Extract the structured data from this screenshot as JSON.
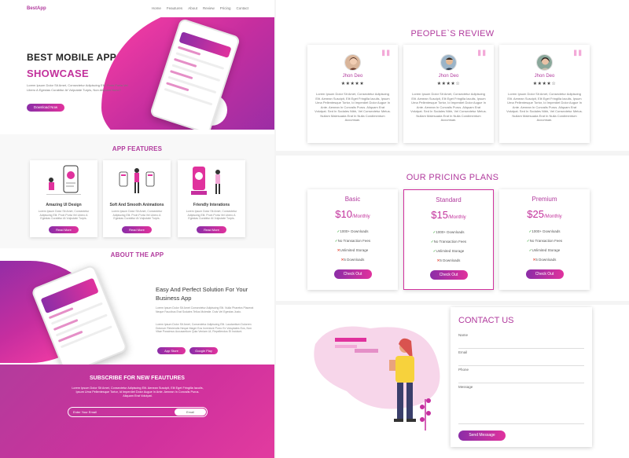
{
  "nav": {
    "logo": "BestApp",
    "items": [
      "Home",
      "Feautures",
      "About",
      "Review",
      "Pricing",
      "Contact"
    ]
  },
  "hero": {
    "title": "BEST MOBILE APP",
    "subtitle": "SHOWCASE",
    "text": "Lorem Ipsum Dolor Sit Amet, Consectetur Adipiscing Elit. Proin Porta Vel Libero A Egestas Curabitur At Vulputate Turpis, Non Aliquam Nunc?",
    "button": "Download Now"
  },
  "features": {
    "title": "APP FEATURES",
    "cards": [
      {
        "name": "Amazing UI Design",
        "desc": "Lorem Ipsum Dolor Sit Amet, Consectetur Adipiscing Elit. Proin Porta Vel Libero A Egestas Curabitur At Vulputate Turpis.",
        "button": "Read More"
      },
      {
        "name": "Soft And Smooth Animations",
        "desc": "Lorem Ipsum Dolor Sit Amet, Consectetur Adipiscing Elit. Proin Porta Vel Libero A Egestas Curabitur At Vulputate Turpis.",
        "button": "Read More"
      },
      {
        "name": "Friendly Interations",
        "desc": "Lorem Ipsum Dolor Sit Amet, Consectetur Adipiscing Elit. Proin Porta Vel Libero A Egestas Curabitur At Vulputate Turpis.",
        "button": "Read More"
      }
    ]
  },
  "about": {
    "title": "ABOUT THE APP",
    "heading": "Easy And Perfect Solution For Your Business App",
    "p1": "Lorem Ipsum Dolor Sit Amet Consectetur Adipiscing Elit. Nulla Pharetra Placerat Neque Faucibus Erat Sodales Tellus Molestie. Duis Vel Egestas Justo.",
    "p2": "Lorem Ipsum Dolor Sit Amet, Consectetur Adipiscing Elit. Laudantium Dolorem Dolorum Reiciendis Neque Magni Eos Inventore Porro Ex Voluptates Eos, Non Vitae Possimus Accusantium Quia Veniam Ut, Repellendus Et Incidunt.",
    "store1": "App Store",
    "store2": "Google Play"
  },
  "subscribe": {
    "title": "SUBSCRIBE FOR NEW FEAUTURES",
    "text": "Lorem Ipsum Dolor Sit Amet, Consectetur Adipiscing Elit. Aenean Suscipit, Elit Eget Fringilla Iaculis, Ipsum Urna Pellentesque Tortor, Id Imperdiet Dolor Augue In Ante. Aenean In Convalis Purus. Aliquam Erat Volutpat.",
    "placeholder": "Enter Your Email",
    "button": "Email"
  },
  "reviews": {
    "title": "PEOPLE`S REVIEW",
    "cards": [
      {
        "name": "Jhon Deo",
        "stars": "★★★★★",
        "text": "Lorem Ipsum Dolor Sit Amet, Consectetur Adipiscing Elit. Aenean Suscipit, Elit Eget Fringilla Iaculis, Ipsum Urna Pellentesque Tortor, Id Imperdiet Dolor Augue In Ante. Aenean In Convalis Purus. Aliquam Erat Volutpat. Sed In Sodales Nibh, Vel Consectetur Metus. Nullam Malesuada Erat In Nulla Condimentum Accumsan."
      },
      {
        "name": "Jhon Deo",
        "stars": "★★★★☆",
        "text": "Lorem Ipsum Dolor Sit Amet, Consectetur Adipiscing Elit. Aenean Suscipit, Elit Eget Fringilla Iaculis, Ipsum Urna Pellentesque Tortor, Id Imperdiet Dolor Augue In Ante. Aenean In Convalis Purus. Aliquam Erat Volutpat. Sed In Sodales Nibh, Vel Consectetur Metus. Nullam Malesuada Erat In Nulla Condimentum Accumsan."
      },
      {
        "name": "Jhon Deo",
        "stars": "★★★★☆",
        "text": "Lorem Ipsum Dolor Sit Amet, Consectetur Adipiscing Elit. Aenean Suscipit, Elit Eget Fringilla Iaculis, Ipsum Urna Pellentesque Tortor, Id Imperdiet Dolor Augue In Ante. Aenean In Convalis Purus. Aliquam Erat Volutpat. Sed In Sodales Nibh, Vel Consectetur Metus. Nullam Malesuada Erat In Nulla Condimentum Accumsan."
      }
    ]
  },
  "pricing": {
    "title": "OUR PRICING PLANS",
    "plans": [
      {
        "name": "Basic",
        "price": "$10",
        "period": "/Monthly",
        "f1": "1000+ Downloads",
        "f2": "No Transaction Fees",
        "f3": "Unlimited Storage",
        "f4": "5 Downloads",
        "button": "Check Out"
      },
      {
        "name": "Standard",
        "price": "$15",
        "period": "/Monthly",
        "f1": "1000+ Downloads",
        "f2": "No Transaction Fees",
        "f3": "Unlimited Storage",
        "f4": "5 Downloads",
        "button": "Check Out"
      },
      {
        "name": "Premium",
        "price": "$25",
        "period": "/Monthly",
        "f1": "1000+ Downloads",
        "f2": "No Transaction Fees",
        "f3": "Unlimited Storage",
        "f4": "5 Downloads",
        "button": "Check Out"
      }
    ]
  },
  "contact": {
    "title": "CONTACT US",
    "name": "Name",
    "email": "Email",
    "phone": "Phone",
    "message": "Message",
    "button": "Send Message"
  }
}
